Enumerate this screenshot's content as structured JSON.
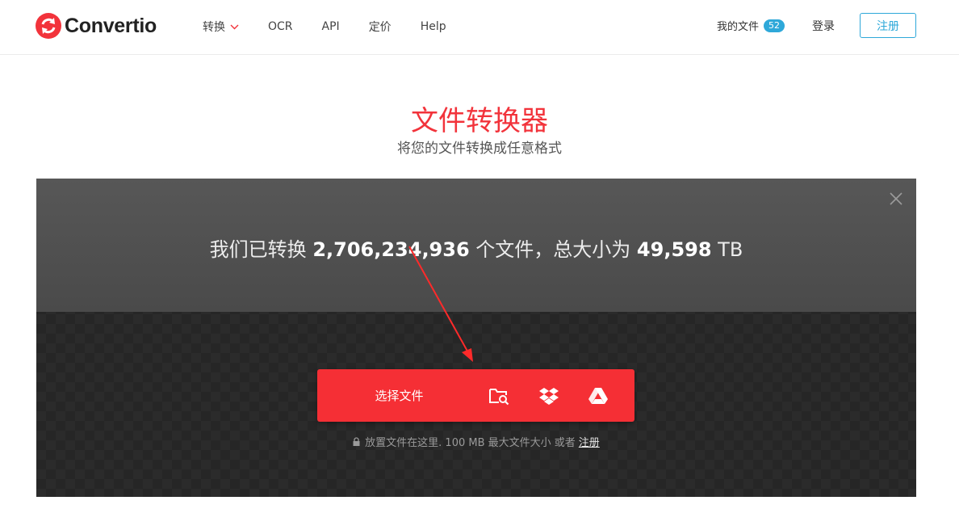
{
  "header": {
    "logo_text": "Convertio",
    "nav": [
      {
        "label": "转换",
        "has_dropdown": true
      },
      {
        "label": "OCR"
      },
      {
        "label": "API"
      },
      {
        "label": "定价"
      },
      {
        "label": "Help"
      }
    ],
    "my_files_label": "我的文件",
    "my_files_count": "52",
    "login_label": "登录",
    "signup_label": "注册"
  },
  "hero": {
    "title": "文件转换器",
    "subtitle": "将您的文件转换成任意格式"
  },
  "panel": {
    "stats_prefix": "我们已转换 ",
    "files_count": "2,706,234,936",
    "stats_mid": " 个文件，总大小为 ",
    "total_size": "49,598",
    "size_unit": " TB",
    "choose_label": "选择文件",
    "hint_text": "放置文件在这里. 100 MB 最大文件大小 或者",
    "hint_link": "注册",
    "icons": [
      "folder-search-icon",
      "dropbox-icon",
      "google-drive-icon",
      "close-icon",
      "lock-icon"
    ]
  },
  "colors": {
    "brand_red": "#f2333b",
    "button_red": "#f52f35",
    "accent_blue": "#2ea8d9"
  }
}
